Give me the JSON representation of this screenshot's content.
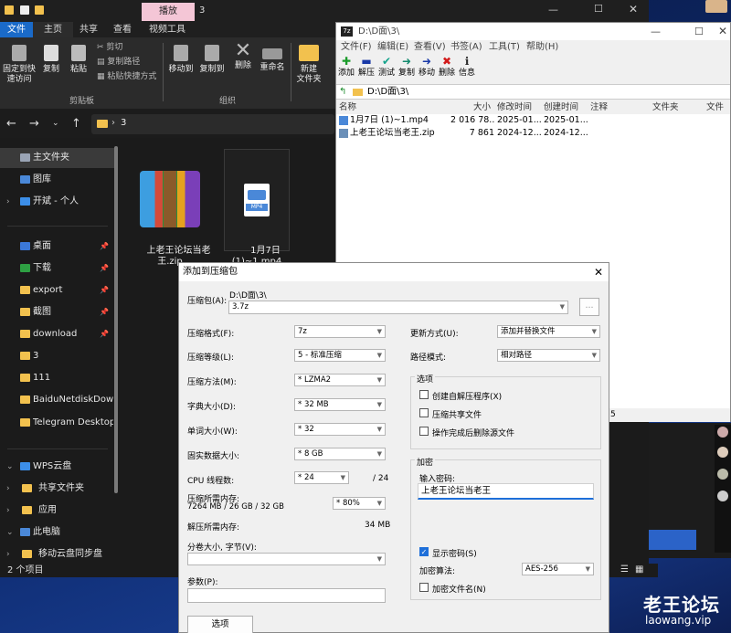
{
  "explorer": {
    "title_tab_highlight": "播放",
    "title_path": "3",
    "ribbon_tabs": [
      "文件",
      "主页",
      "共享",
      "查看",
      "视频工具"
    ],
    "ribbon": {
      "pin_label": "固定到快\n速访问",
      "copy_label": "复制",
      "paste_label": "粘贴",
      "cut_label": "剪切",
      "copy_path_label": "复制路径",
      "paste_shortcut_label": "粘贴快捷方式",
      "clipboard_group": "剪贴板",
      "move_to_label": "移动到",
      "copy_to_label": "复制到",
      "delete_label": "删除",
      "rename_label": "重命名",
      "organize_group": "组织",
      "new_folder_label": "新建\n文件夹"
    },
    "address": {
      "separator": "›",
      "folder": "3"
    },
    "sidebar": [
      {
        "label": "主文件夹",
        "icon": "home-icon",
        "selected": true
      },
      {
        "label": "图库",
        "icon": "gallery-icon"
      },
      {
        "label": "开斌 - 个人",
        "icon": "cloud-icon"
      },
      {
        "label": "桌面",
        "icon": "desktop-icon",
        "pinned": true
      },
      {
        "label": "下载",
        "icon": "download-icon",
        "pinned": true
      },
      {
        "label": "export",
        "icon": "folder-icon",
        "pinned": true
      },
      {
        "label": "截图",
        "icon": "folder-icon",
        "pinned": true
      },
      {
        "label": "download",
        "icon": "folder-icon",
        "pinned": true
      },
      {
        "label": "3",
        "icon": "folder-icon"
      },
      {
        "label": "111",
        "icon": "folder-icon"
      },
      {
        "label": "BaiduNetdiskDownl",
        "icon": "folder-icon"
      },
      {
        "label": "Telegram Desktop",
        "icon": "folder-icon"
      },
      {
        "label": "WPS云盘",
        "icon": "cloud-icon"
      },
      {
        "label": "共享文件夹",
        "icon": "folder-icon"
      },
      {
        "label": "应用",
        "icon": "folder-icon"
      },
      {
        "label": "此电脑",
        "icon": "computer-icon"
      },
      {
        "label": "移动云盘同步盘",
        "icon": "folder-icon"
      }
    ],
    "files": [
      {
        "name": "上老王论坛当老\n王.zip",
        "icon": "winrar-icon"
      },
      {
        "name": "1月7日\n(1)~1.mp4",
        "icon": "mp4-icon",
        "badge": "MP4"
      }
    ],
    "status": "2 个项目"
  },
  "sevenzip": {
    "title": "D:\\D面\\3\\",
    "menu": [
      "文件(F)",
      "编辑(E)",
      "查看(V)",
      "书签(A)",
      "工具(T)",
      "帮助(H)"
    ],
    "toolbar": [
      {
        "label": "添加",
        "glyph": "✚",
        "color": "#1a9b2a"
      },
      {
        "label": "解压",
        "glyph": "▬",
        "color": "#1a3aa8"
      },
      {
        "label": "测试",
        "glyph": "✔",
        "color": "#14a38b"
      },
      {
        "label": "复制",
        "glyph": "➜",
        "color": "#148a6e"
      },
      {
        "label": "移动",
        "glyph": "➜",
        "color": "#1a3aa8"
      },
      {
        "label": "删除",
        "glyph": "✖",
        "color": "#d21a1a"
      },
      {
        "label": "信息",
        "glyph": "ℹ",
        "color": "#2b2b2b"
      }
    ],
    "address": "D:\\D面\\3\\",
    "columns": [
      "名称",
      "大小",
      "修改时间",
      "创建时间",
      "注释",
      "文件夹",
      "文件"
    ],
    "rows": [
      {
        "name": "1月7日 (1)~1.mp4",
        "size": "2 016 78...",
        "modified": "2025-01...",
        "created": "2025-01..."
      },
      {
        "name": "上老王论坛当老王.zip",
        "size": "7 861",
        "modified": "2024-12...",
        "created": "2024-12..."
      }
    ],
    "status": "5"
  },
  "dialog": {
    "title": "添加到压缩包",
    "archive_label": "压缩包(A):",
    "archive_dir": "D:\\D面\\3\\",
    "archive_name": "3.7z",
    "browse": "...",
    "left": [
      {
        "label": "压缩格式(F):",
        "value": "7z"
      },
      {
        "label": "压缩等级(L):",
        "value": "5 - 标准压缩"
      },
      {
        "label": "压缩方法(M):",
        "value": "* LZMA2"
      },
      {
        "label": "字典大小(D):",
        "value": "* 32 MB"
      },
      {
        "label": "单词大小(W):",
        "value": "* 32"
      },
      {
        "label": "固实数据大小:",
        "value": "* 8 GB"
      }
    ],
    "threads_label": "CPU 线程数:",
    "threads_value": "* 24",
    "threads_max": "/ 24",
    "mem_label": "压缩所需内存:",
    "mem_detail": "7264 MB / 26 GB / 32 GB",
    "mem_value": "* 80%",
    "unpack_label": "解压所需内存:",
    "unpack_value": "34 MB",
    "split_label": "分卷大小, 字节(V):",
    "params_label": "参数(P):",
    "options_button": "选项",
    "update_label": "更新方式(U):",
    "update_value": "添加并替换文件",
    "path_label": "路径模式:",
    "path_value": "相对路径",
    "options_group": "选项",
    "opt_sfx": "创建自解压程序(X)",
    "opt_shared": "压缩共享文件",
    "opt_delete": "操作完成后删除源文件",
    "enc_group": "加密",
    "pwd_label": "输入密码:",
    "pwd_value": "上老王论坛当老王",
    "show_pwd": "显示密码(S)",
    "enc_method_label": "加密算法:",
    "enc_method_value": "AES-256",
    "enc_names": "加密文件名(N)"
  },
  "watermark": {
    "main": "老王论坛",
    "sub": "laowang.vip"
  }
}
